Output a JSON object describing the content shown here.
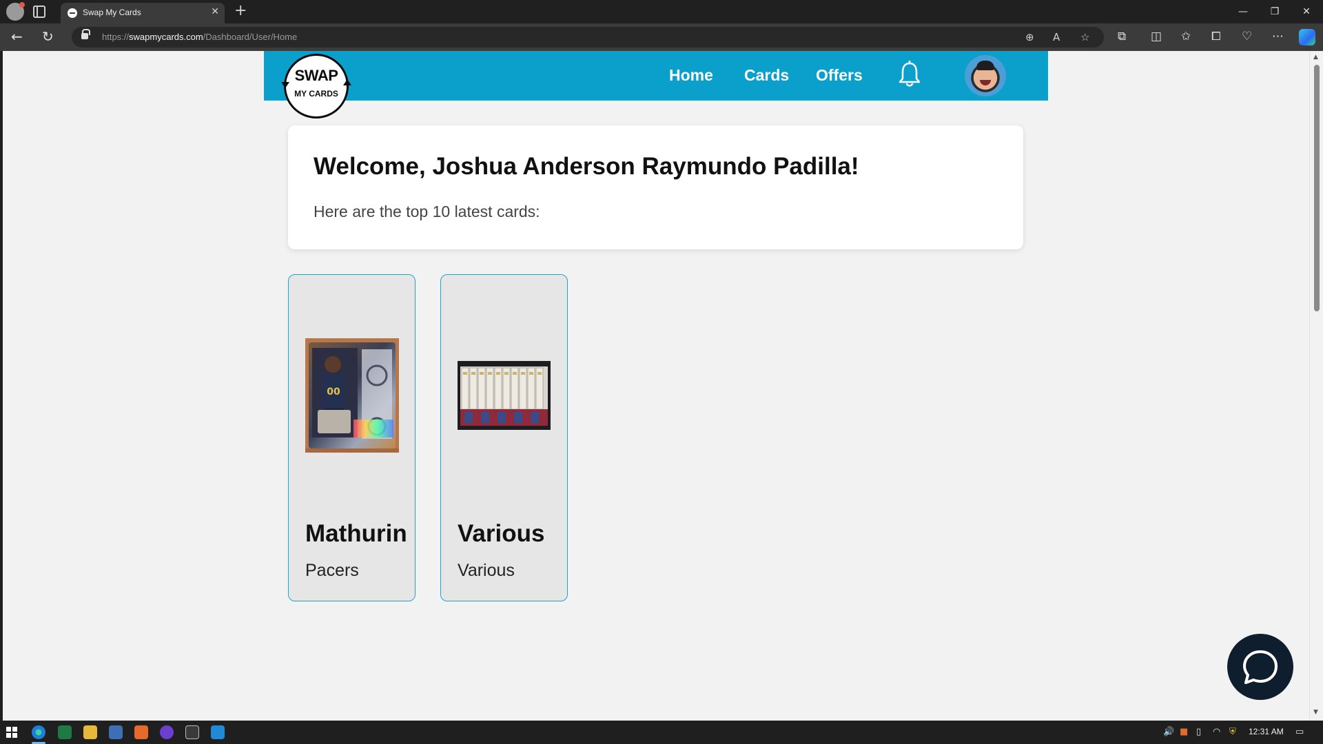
{
  "browser": {
    "tab_title": "Swap My Cards",
    "tab_close": "✕",
    "new_tab": "+",
    "url_scheme": "https://",
    "url_host": "swapmycards.com",
    "url_path": "/Dashboard/User/Home",
    "window_minimize": "—",
    "window_restore": "❐",
    "window_close": "✕"
  },
  "site": {
    "logo_top": "SWAP",
    "logo_bottom": "MY CARDS",
    "nav": {
      "home": "Home",
      "cards": "Cards",
      "offers": "Offers"
    },
    "header_color": "#0aa0cb"
  },
  "welcome": {
    "title": "Welcome, Joshua Anderson Raymundo Padilla!",
    "subtitle": "Here are the top 10 latest cards:"
  },
  "cards": [
    {
      "name": "Mathurin",
      "team": "Pacers"
    },
    {
      "name": "Various",
      "team": "Various"
    }
  ],
  "taskbar": {
    "time": "12:31 AM"
  }
}
